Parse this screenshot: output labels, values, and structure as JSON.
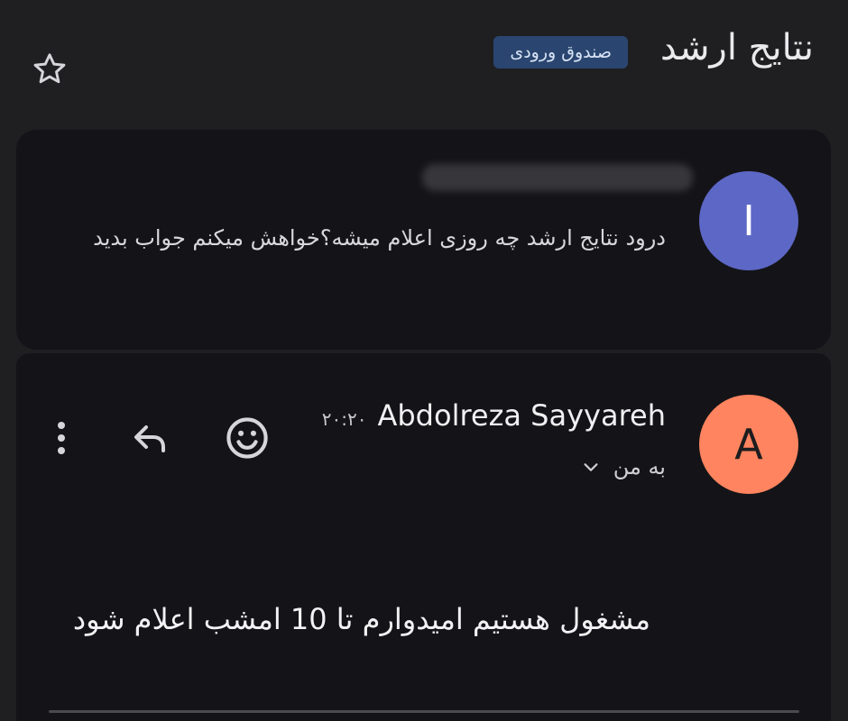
{
  "header": {
    "subject": "نتایج ارشد",
    "label_chip": "صندوق ورودی",
    "star_icon": "star-outline-icon"
  },
  "messages": [
    {
      "avatar_letter": "I",
      "avatar_color": "#5d67c6",
      "snippet": "درود نتایج ارشد چه روزی اعلام میشه؟خواهش میکنم جواب بدید"
    },
    {
      "avatar_letter": "A",
      "avatar_color": "#ff845f",
      "sender_name": "Abdolreza Sayyareh",
      "time": "۲۰:۲۰",
      "recipient": "به من",
      "body": "مشغول هستیم امیدوارم تا 10 امشب اعلام شود",
      "actions": [
        "emoji-reaction-icon",
        "reply-icon",
        "more-vert-icon"
      ]
    }
  ]
}
